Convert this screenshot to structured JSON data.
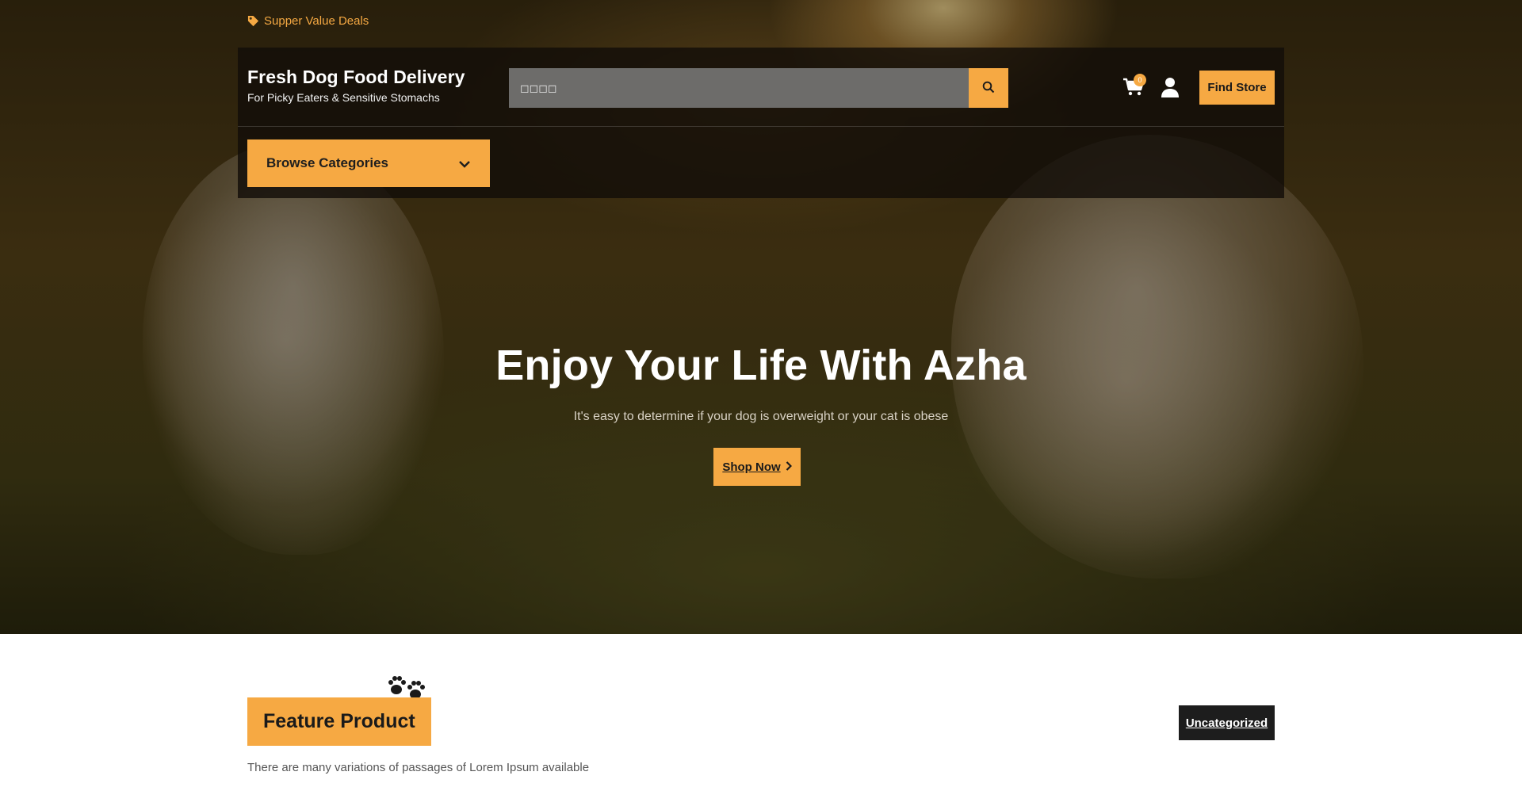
{
  "top_strip": {
    "deals_label": "Supper Value Deals",
    "icon": "tag-icon"
  },
  "header": {
    "brand_title": "Fresh Dog Food Delivery",
    "brand_subtitle": "For Picky Eaters & Sensitive Stomachs",
    "search": {
      "value": "",
      "placeholder": "◻◻◻◻"
    },
    "cart_count": "0",
    "find_store_label": "Find Store",
    "browse_label": "Browse Categories"
  },
  "hero": {
    "title": "Enjoy Your Life With Azha",
    "subtitle": "It's easy to determine if your dog is overweight or your cat is obese",
    "cta_label": "Shop Now"
  },
  "feature": {
    "title": "Feature Product",
    "subtitle": "There are many variations of passages of Lorem Ipsum available",
    "category_button": "Uncategorized"
  },
  "colors": {
    "accent": "#f6a943",
    "dark": "#1d1d1d",
    "header_bg": "#120e08"
  }
}
